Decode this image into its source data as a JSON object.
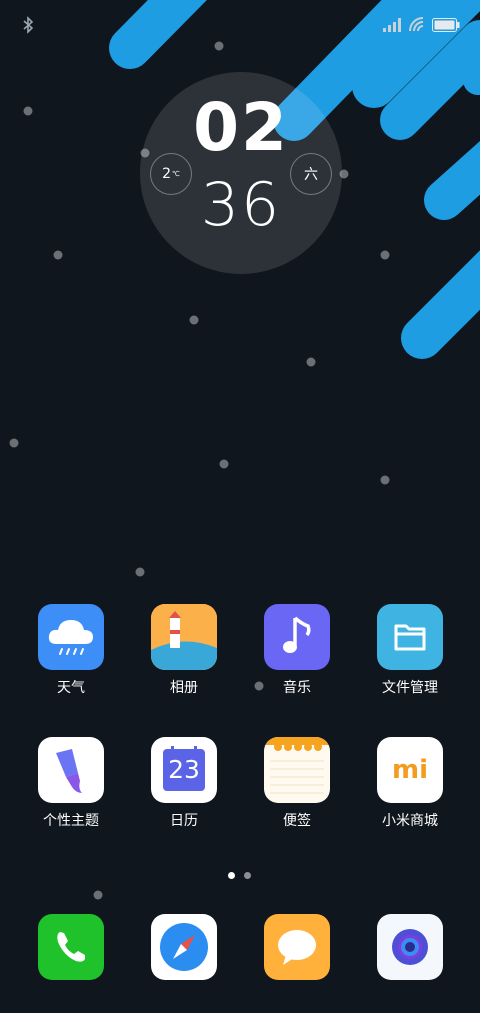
{
  "clock": {
    "hour": "02",
    "minute": "36",
    "temperature": "2",
    "temperature_unit": "℃",
    "weekday": "六"
  },
  "home_apps": [
    {
      "label": "天气",
      "icon": "weather-cloud-icon"
    },
    {
      "label": "相册",
      "icon": "lighthouse-gallery-icon"
    },
    {
      "label": "音乐",
      "icon": "music-note-icon"
    },
    {
      "label": "文件管理",
      "icon": "folder-icon"
    },
    {
      "label": "个性主题",
      "icon": "paintbrush-theme-icon"
    },
    {
      "label": "日历",
      "icon": "calendar-icon",
      "date": "23"
    },
    {
      "label": "便签",
      "icon": "notepad-icon"
    },
    {
      "label": "小米商城",
      "icon": "mi-store-icon",
      "logo": "mi"
    }
  ],
  "dock_apps": [
    {
      "icon": "phone-icon"
    },
    {
      "icon": "compass-browser-icon"
    },
    {
      "icon": "message-bubble-icon"
    },
    {
      "icon": "camera-lens-icon"
    }
  ],
  "page_indicator": {
    "pages": 2,
    "current": 1
  },
  "colors": {
    "background": "#0f161d",
    "wallpaper_accent": "#1e9be0",
    "weather": "#3d8ef7",
    "music": "#6a67f4",
    "files": "#3fb4e2",
    "phone": "#1fc22b",
    "messages": "#ffb13b"
  }
}
